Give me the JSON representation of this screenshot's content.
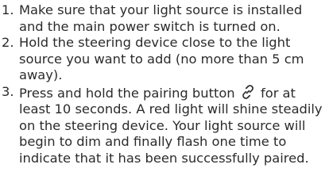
{
  "steps": [
    {
      "number": "1.",
      "text": "Make sure that your light source is installed and the main power switch is turned on."
    },
    {
      "number": "2.",
      "text": "Hold the steering device close to the light source you want to add (no more than 5 cm away)."
    },
    {
      "number": "3.",
      "text_before_icon": "Press and hold the pairing button",
      "icon": "link-icon",
      "text_after_icon": "for at least 10 seconds. A red light will shine steadily on the steering device. Your light source will begin to dim and finally flash one time to indicate that it has been successfully paired."
    }
  ]
}
